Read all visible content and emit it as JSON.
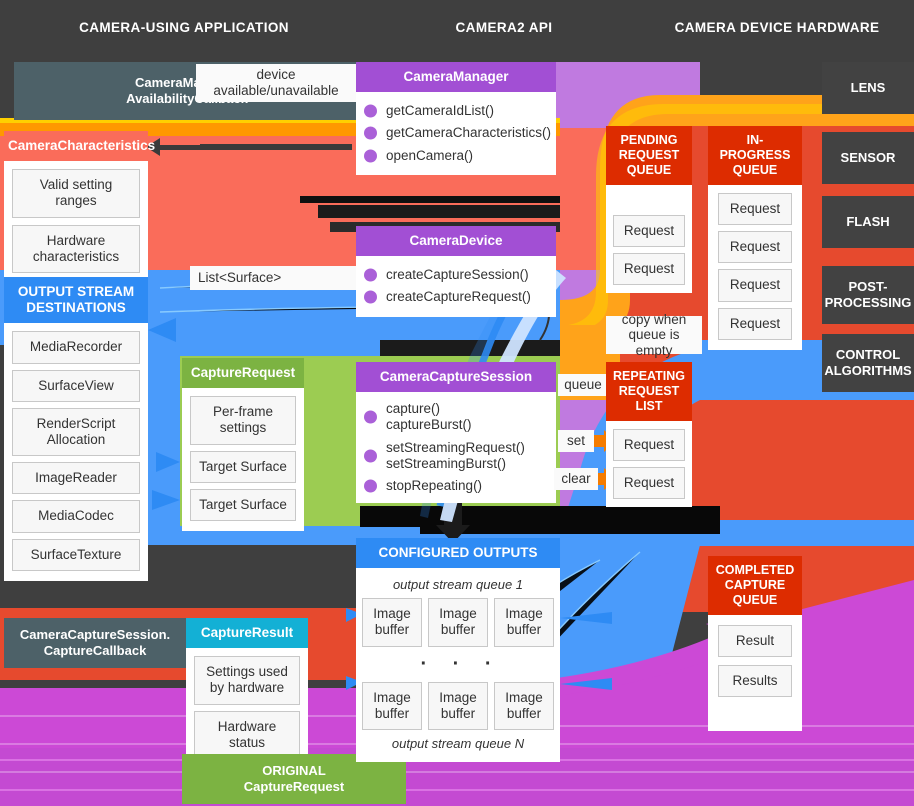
{
  "columns": [
    {
      "id": "app",
      "label": "CAMERA-USING APPLICATION"
    },
    {
      "id": "api",
      "label": "CAMERA2 API"
    },
    {
      "id": "hardware",
      "label": "CAMERA DEVICE HARDWARE"
    }
  ],
  "colors": {
    "background_dark": "#3f3f3f",
    "plate_dark": "#424242",
    "plate_slate": "#4d6168",
    "purple": "#a24fd4",
    "purple_flow": "#c07ae0",
    "red": "#dd2c00",
    "red_flow": "#e64a2e",
    "salmon": "#fa6c5a",
    "blue": "#2e8bf4",
    "blue_flow": "#4a9bfb",
    "green": "#7cb342",
    "green_flow": "#9ccc52",
    "cyan": "#13b0d5",
    "orange": "#ff9800",
    "orange_flow": "#ffa31a",
    "magenta_flow": "#cc49d6",
    "white": "#ffffff",
    "chip_border": "#c8c8c8",
    "chip_fill": "#f7f7f7"
  },
  "app": {
    "availability_callback": "CameraManager.\nAvailabilityCallback",
    "availability_callback_lines": [
      "CameraManager.",
      "AvailabilityCallback"
    ],
    "camera_characteristics": {
      "title": "CameraCharacteristics",
      "items": [
        "Valid setting\nranges",
        "Hardware\ncharacteristics"
      ],
      "items_lines": [
        [
          "Valid setting",
          "ranges"
        ],
        [
          "Hardware",
          "characteristics"
        ]
      ]
    },
    "output_stream_destinations": {
      "title": "OUTPUT STREAM\nDESTINATIONS",
      "title_lines": [
        "OUTPUT STREAM",
        "DESTINATIONS"
      ],
      "items": [
        "MediaRecorder",
        "SurfaceView",
        "RenderScript\nAllocation",
        "ImageReader",
        "MediaCodec",
        "SurfaceTexture"
      ]
    },
    "capture_request": {
      "title": "CaptureRequest",
      "items": [
        "Per-frame\nsettings",
        "Target Surface",
        "Target Surface"
      ]
    },
    "capture_callback": {
      "lines": [
        "CameraCaptureSession.",
        "CaptureCallback"
      ]
    },
    "capture_result": {
      "title": "CaptureResult",
      "items": [
        "Settings used\nby hardware",
        "Hardware\nstatus"
      ]
    },
    "original_capture_request": {
      "lines": [
        "ORIGINAL",
        "CaptureRequest"
      ]
    }
  },
  "api": {
    "camera_manager": {
      "title": "CameraManager",
      "methods": [
        "getCameraIdList()",
        "getCameraCharacteristics()",
        "openCamera()"
      ]
    },
    "camera_device": {
      "title": "CameraDevice",
      "methods": [
        "createCaptureSession()",
        "createCaptureRequest()"
      ]
    },
    "camera_capture_session": {
      "title": "CameraCaptureSession",
      "methods": [
        "capture()\ncaptureBurst()",
        "setStreamingRequest()\nsetStreamingBurst()",
        "stopRepeating()"
      ],
      "methods_lines": [
        [
          "capture()",
          "captureBurst()"
        ],
        [
          "setStreamingRequest()",
          "setStreamingBurst()"
        ],
        [
          "stopRepeating()"
        ]
      ]
    },
    "configured_outputs": {
      "title": "CONFIGURED OUTPUTS",
      "queue_first_label": "output stream queue 1",
      "queue_last_label": "output stream queue N",
      "buffer_label": "Image\nbuffer",
      "buffer_label_lines": [
        "Image",
        "buffer"
      ],
      "ellipsis": "·  ·  ·",
      "row_count": 3
    },
    "edge_labels": {
      "device_availability": "device\navailable/unavailable",
      "device_availability_lines": [
        "device",
        "available/unavailable"
      ],
      "list_surface": "List<Surface>",
      "queue": "queue",
      "set": "set",
      "clear": "clear",
      "copy_when_empty": "copy when\nqueue is empty",
      "copy_when_empty_lines": [
        "copy when",
        "queue is empty"
      ]
    }
  },
  "hardware": {
    "pending_request_queue": {
      "title": "PENDING\nREQUEST\nQUEUE",
      "title_lines": [
        "PENDING",
        "REQUEST",
        "QUEUE"
      ],
      "items": [
        "Request",
        "Request"
      ]
    },
    "in_progress_queue": {
      "title": "IN-PROGRESS\nQUEUE",
      "title_lines": [
        "IN-PROGRESS",
        "QUEUE"
      ],
      "items": [
        "Request",
        "Request",
        "Request",
        "Request"
      ]
    },
    "repeating_request_list": {
      "title": "REPEATING\nREQUEST\nLIST",
      "title_lines": [
        "REPEATING",
        "REQUEST",
        "LIST"
      ],
      "items": [
        "Request",
        "Request"
      ]
    },
    "completed_capture_queue": {
      "title": "COMPLETED\nCAPTURE\nQUEUE",
      "title_lines": [
        "COMPLETED",
        "CAPTURE",
        "QUEUE"
      ],
      "items": [
        "Result",
        "Results"
      ]
    },
    "pipeline": [
      "LENS",
      "SENSOR",
      "FLASH",
      "POST-\nPROCESSING",
      "CONTROL\nALGORITHMS"
    ],
    "pipeline_lines": [
      [
        "LENS"
      ],
      [
        "SENSOR"
      ],
      [
        "FLASH"
      ],
      [
        "POST-",
        "PROCESSING"
      ],
      [
        "CONTROL",
        "ALGORITHMS"
      ]
    ]
  }
}
